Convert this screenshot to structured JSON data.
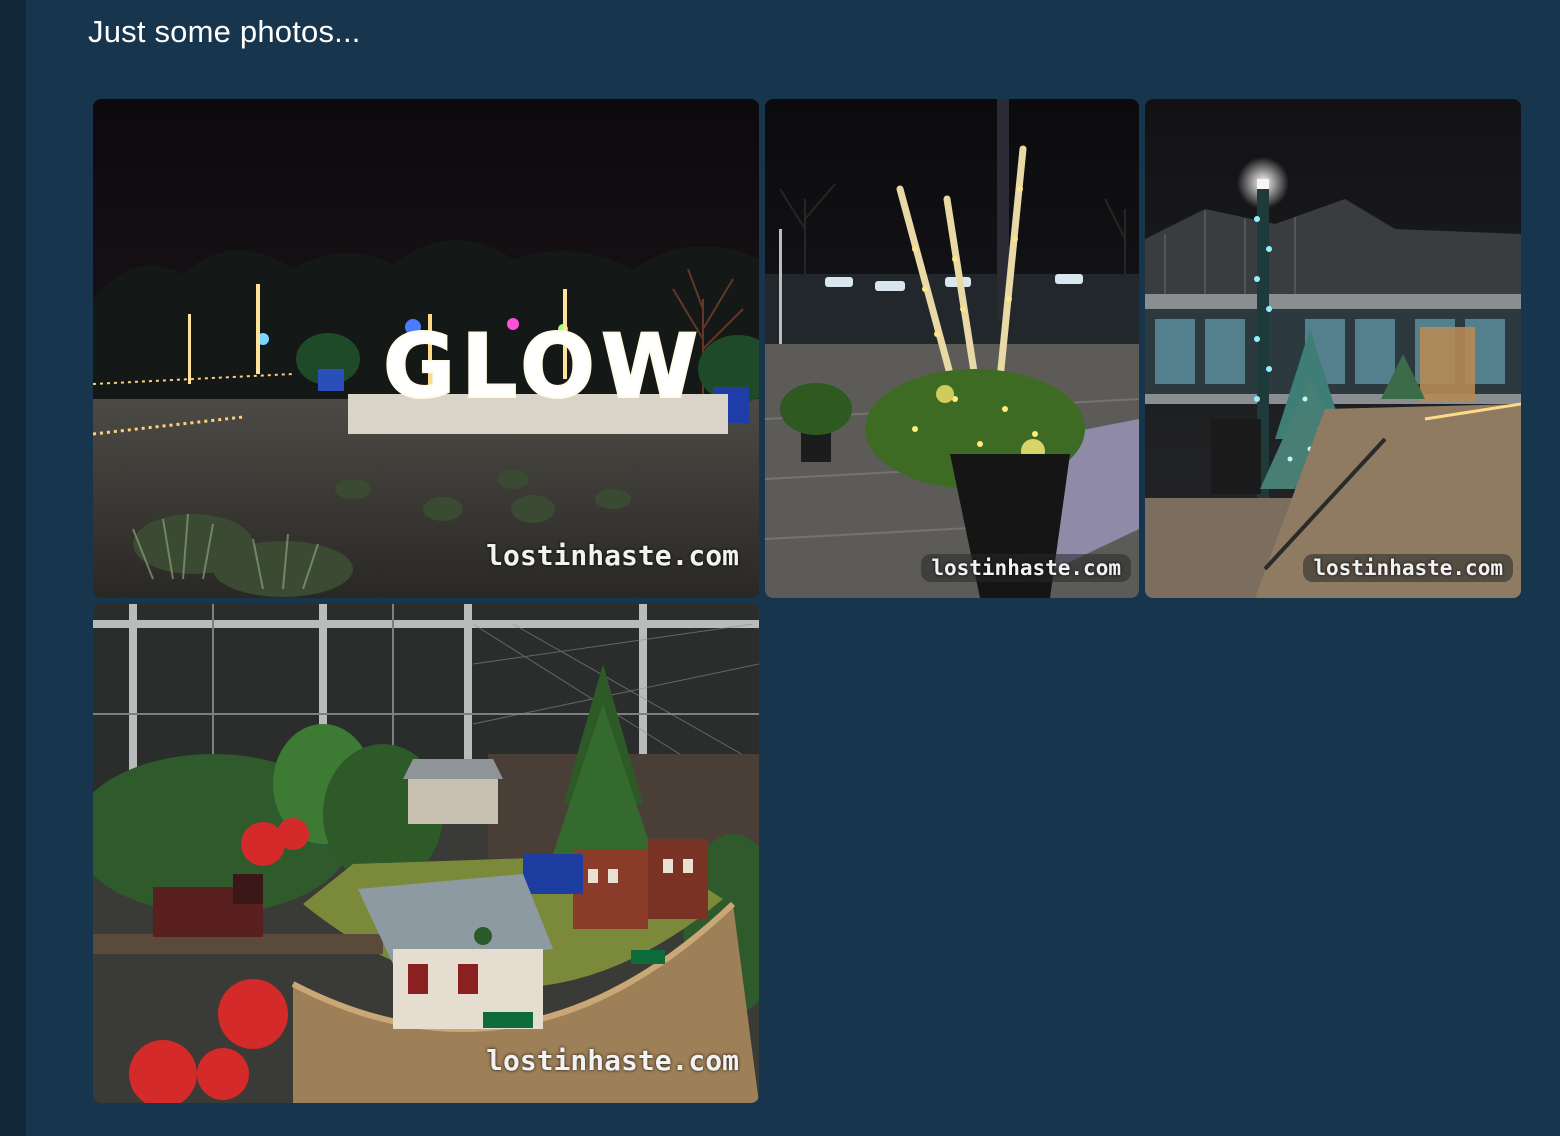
{
  "post": {
    "text": "Just some photos..."
  },
  "photos": [
    {
      "watermark": "lostinhaste.com",
      "sign_text": "GLOW"
    },
    {
      "watermark": "lostinhaste.com"
    },
    {
      "watermark": "lostinhaste.com"
    },
    {
      "watermark": "lostinhaste.com"
    }
  ],
  "colors": {
    "page_background": "#17354d",
    "left_rail": "#12293b",
    "text": "#ffffff"
  }
}
